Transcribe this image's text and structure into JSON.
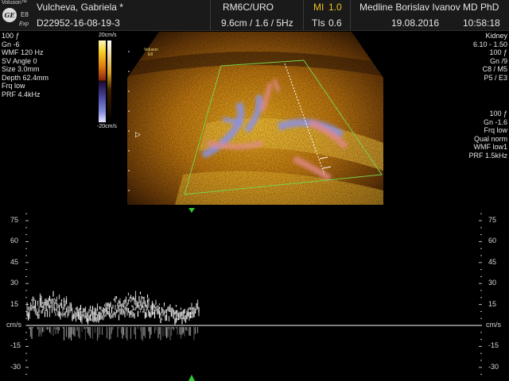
{
  "header": {
    "brand": "Voluson™",
    "brand_model": "E8",
    "brand_variant": "Exp",
    "patient_name": "Vulcheva, Gabriela  *",
    "patient_id": "D22952-16-08-19-3",
    "probe": "RM6C/URO",
    "probe_settings": "9.6cm / 1.6 / 5Hz",
    "mi_label": "MI",
    "mi_value": "1.0",
    "tis_label": "TIs",
    "tis_value": "0.6",
    "institution": "Medline Borislav Ivanov MD PhD",
    "date": "19.08.2016",
    "time": "10:58:18"
  },
  "left_panel": [
    "100 ƒ",
    "Gn  -6",
    "WMF 120 Hz",
    "SV Angle  0",
    "Size  3.0mm",
    "Depth 62.4mm",
    "Frq low",
    "PRF  4.4kHz"
  ],
  "colorbar": {
    "top_label": "20cm/s",
    "bottom_label": "-20cm/s"
  },
  "image_labels": {
    "brand": "Voluson",
    "model": "E8"
  },
  "right_panel_top": [
    "Kidney",
    "6.10 - 1.50",
    "100 ƒ",
    "Gn  /9",
    "C8 / M5",
    "P5 / E3"
  ],
  "right_panel_bottom": [
    "100 ƒ",
    "Gn  -1.6",
    "Frq low",
    "Qual norm",
    "WMF low1",
    "PRF  1.5kHz"
  ],
  "doppler": {
    "left_ticks": [
      "75",
      "60",
      "45",
      "30",
      "15",
      "cm/s",
      "-15",
      "-30"
    ],
    "right_ticks": [
      "75",
      "60",
      "45",
      "30",
      "15",
      "cm/s",
      "-15",
      "-30"
    ],
    "scale_max": 75,
    "scale_min": -30
  },
  "colors": {
    "accent_yellow": "#f0c020",
    "roi_green": "#7ad24a",
    "marker_green": "#2ecc2e"
  }
}
